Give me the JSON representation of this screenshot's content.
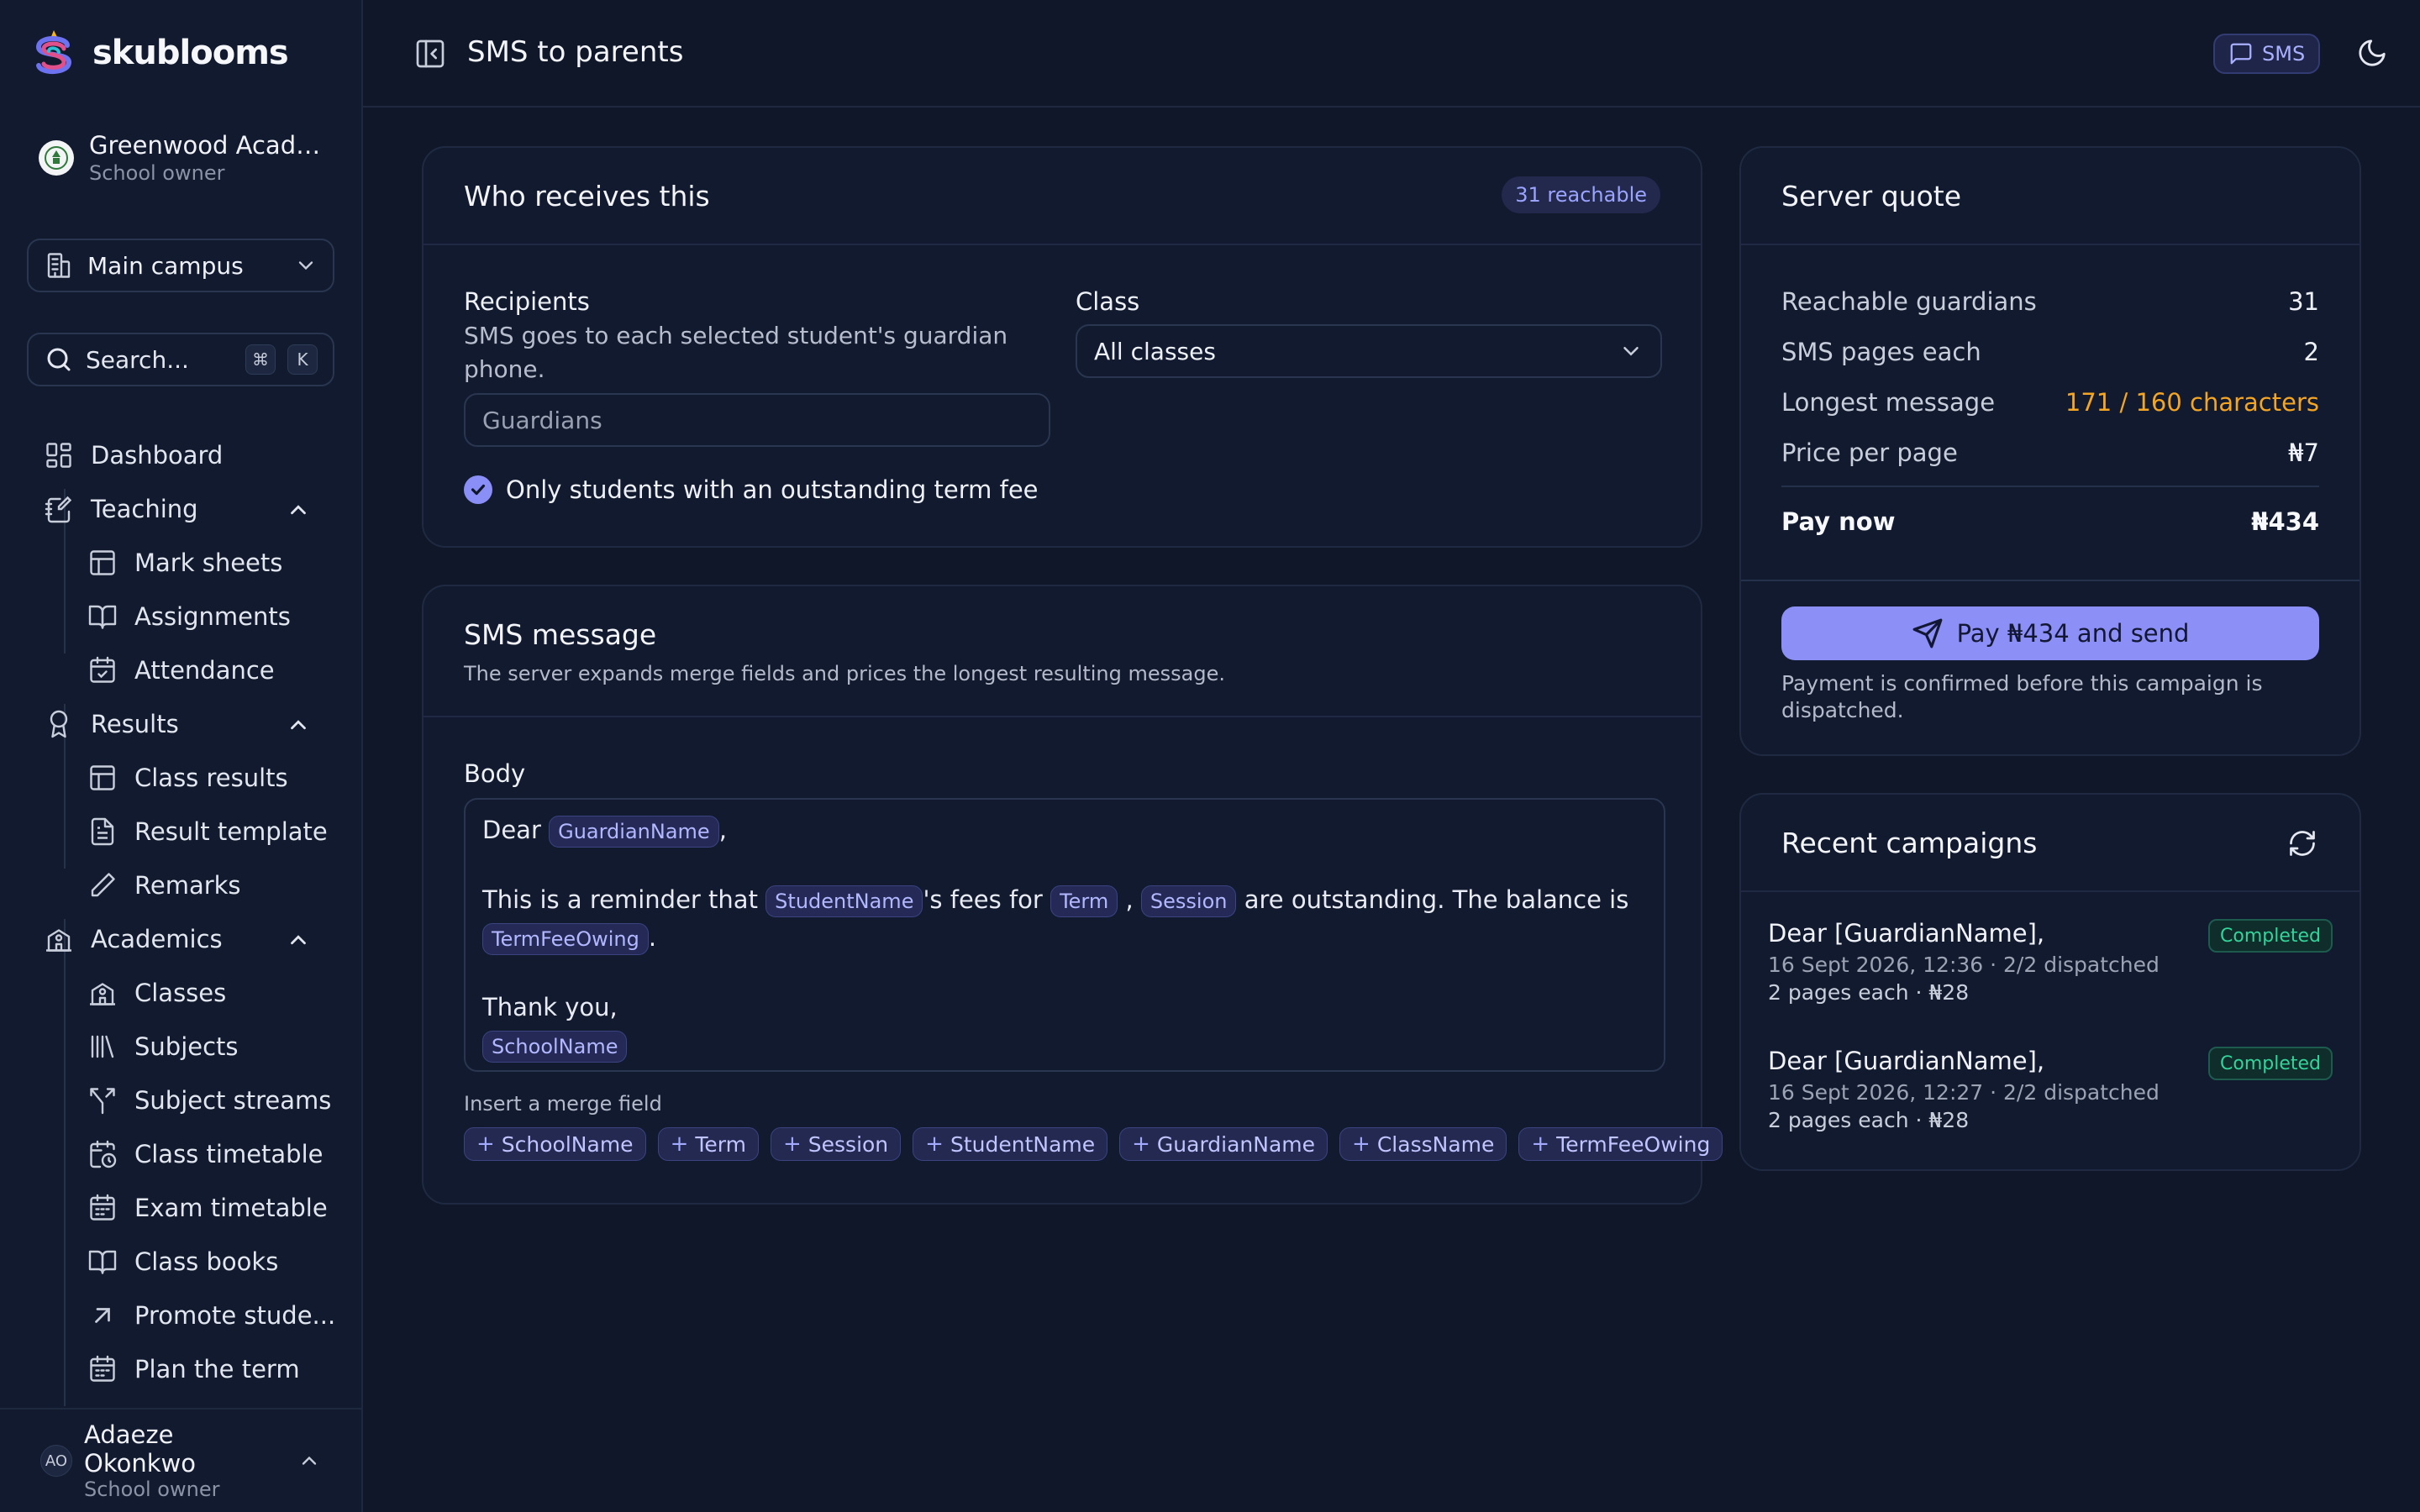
{
  "brand": {
    "name": "skublooms"
  },
  "school": {
    "name": "Greenwood Academy",
    "role": "School owner"
  },
  "campus": {
    "label": "Main campus"
  },
  "search": {
    "label": "Search...",
    "shortcut_cmd": "⌘",
    "shortcut_key": "K"
  },
  "nav": {
    "dashboard": "Dashboard",
    "teaching": "Teaching",
    "mark_sheets": "Mark sheets",
    "assignments": "Assignments",
    "attendance": "Attendance",
    "results": "Results",
    "class_results": "Class results",
    "result_template": "Result template",
    "remarks": "Remarks",
    "academics": "Academics",
    "classes": "Classes",
    "subjects": "Subjects",
    "subject_streams": "Subject streams",
    "class_timetable": "Class timetable",
    "exam_timetable": "Exam timetable",
    "class_books": "Class books",
    "promote_students": "Promote stude...",
    "plan_term": "Plan the term"
  },
  "user": {
    "initials": "AO",
    "name": "Adaeze Okonkwo",
    "role": "School owner"
  },
  "topbar": {
    "title": "SMS to parents",
    "sms_label": "SMS"
  },
  "recipients_card": {
    "title": "Who receives this",
    "reachable_badge": "31 reachable",
    "recipients_label": "Recipients",
    "recipients_help": "SMS goes to each selected student's guardian phone.",
    "recipients_placeholder": "Guardians",
    "class_label": "Class",
    "class_value": "All classes",
    "outstanding_label": "Only students with an outstanding term fee"
  },
  "message_card": {
    "title": "SMS message",
    "description": "The server expands merge fields and prices the longest resulting message.",
    "body_label": "Body",
    "body": {
      "line1_prefix": "Dear",
      "line1_chip": "GuardianName",
      "line1_suffix": ",",
      "line2_prefix": "This is a reminder that",
      "line2_chip1": "StudentName",
      "line2_mid1": "'s fees for",
      "line2_chip2": "Term",
      "line2_comma": ",",
      "line2_chip3": "Session",
      "line2_mid2": "are outstanding. The balance is",
      "line2_chip4": "TermFeeOwing",
      "line2_end": ".",
      "line3": "Thank you,",
      "line4_chip": "SchoolName"
    },
    "insert_label": "Insert a merge field",
    "merge_fields": [
      "SchoolName",
      "Term",
      "Session",
      "StudentName",
      "GuardianName",
      "ClassName",
      "TermFeeOwing"
    ]
  },
  "quote_card": {
    "title": "Server quote",
    "rows": [
      {
        "key": "Reachable guardians",
        "value": "31"
      },
      {
        "key": "SMS pages each",
        "value": "2"
      },
      {
        "key": "Longest message",
        "value": "171 / 160 characters"
      },
      {
        "key": "Price per page",
        "value": "₦7"
      }
    ],
    "pay_now_label": "Pay now",
    "pay_now_value": "₦434",
    "pay_button": "Pay ₦434 and send",
    "pay_note": "Payment is confirmed before this campaign is dispatched.",
    "warning_color": "#f5a524",
    "accent_color": "#8b8ff6"
  },
  "campaigns_card": {
    "title": "Recent campaigns",
    "items": [
      {
        "title": "Dear [GuardianName],",
        "status": "Completed",
        "meta": "16 Sept 2026, 12:36 · 2/2 dispatched",
        "pages": "2 pages each · ₦28"
      },
      {
        "title": "Dear [GuardianName],",
        "status": "Completed",
        "meta": "16 Sept 2026, 12:27 · 2/2 dispatched",
        "pages": "2 pages each · ₦28"
      }
    ]
  }
}
